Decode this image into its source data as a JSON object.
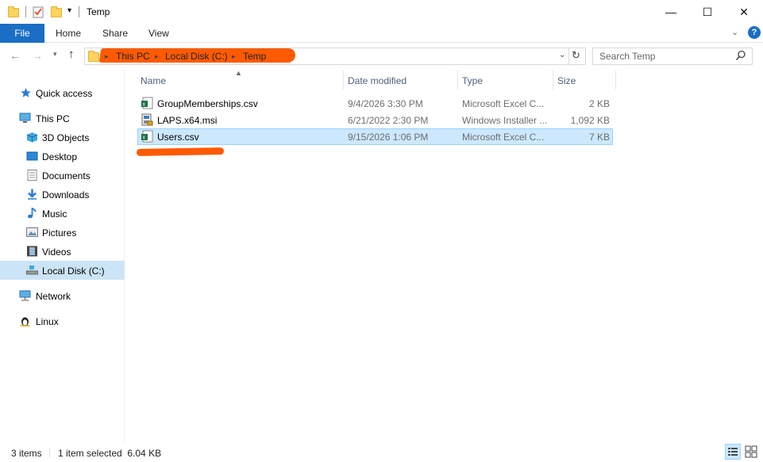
{
  "window": {
    "title": "Temp",
    "minimize": "—",
    "maximize": "☐",
    "close": "✕"
  },
  "ribbon": {
    "tabs": [
      "File",
      "Home",
      "Share",
      "View"
    ],
    "help": "?"
  },
  "address": {
    "crumbs": [
      "This PC",
      "Local Disk (C:)",
      "Temp"
    ],
    "search_placeholder": "Search Temp"
  },
  "sidebar": {
    "items": [
      {
        "label": "Quick access",
        "icon": "star-icon"
      },
      {
        "label": "This PC",
        "icon": "pc-icon"
      },
      {
        "label": "3D Objects",
        "icon": "3d-objects-icon"
      },
      {
        "label": "Desktop",
        "icon": "desktop-icon"
      },
      {
        "label": "Documents",
        "icon": "documents-icon"
      },
      {
        "label": "Downloads",
        "icon": "downloads-icon"
      },
      {
        "label": "Music",
        "icon": "music-icon"
      },
      {
        "label": "Pictures",
        "icon": "pictures-icon"
      },
      {
        "label": "Videos",
        "icon": "videos-icon"
      },
      {
        "label": "Local Disk (C:)",
        "icon": "drive-icon"
      },
      {
        "label": "Network",
        "icon": "network-icon"
      },
      {
        "label": "Linux",
        "icon": "linux-icon"
      }
    ]
  },
  "columns": [
    "Name",
    "Date modified",
    "Type",
    "Size"
  ],
  "files": [
    {
      "name": "GroupMemberships.csv",
      "date": "9/4/2026 3:30 PM",
      "type": "Microsoft Excel C...",
      "size": "2 KB",
      "icon": "excel-csv-icon"
    },
    {
      "name": "LAPS.x64.msi",
      "date": "6/21/2022 2:30 PM",
      "type": "Windows Installer ...",
      "size": "1,092 KB",
      "icon": "msi-installer-icon"
    },
    {
      "name": "Users.csv",
      "date": "9/15/2026 1:06 PM",
      "type": "Microsoft Excel C...",
      "size": "7 KB",
      "icon": "excel-csv-icon",
      "selected": true
    }
  ],
  "status": {
    "count": "3 items",
    "selection": "1 item selected  6.04 KB"
  },
  "colors": {
    "accent": "#1a6ec4",
    "selection": "#cce8ff",
    "redaction": "#ff5a00"
  }
}
